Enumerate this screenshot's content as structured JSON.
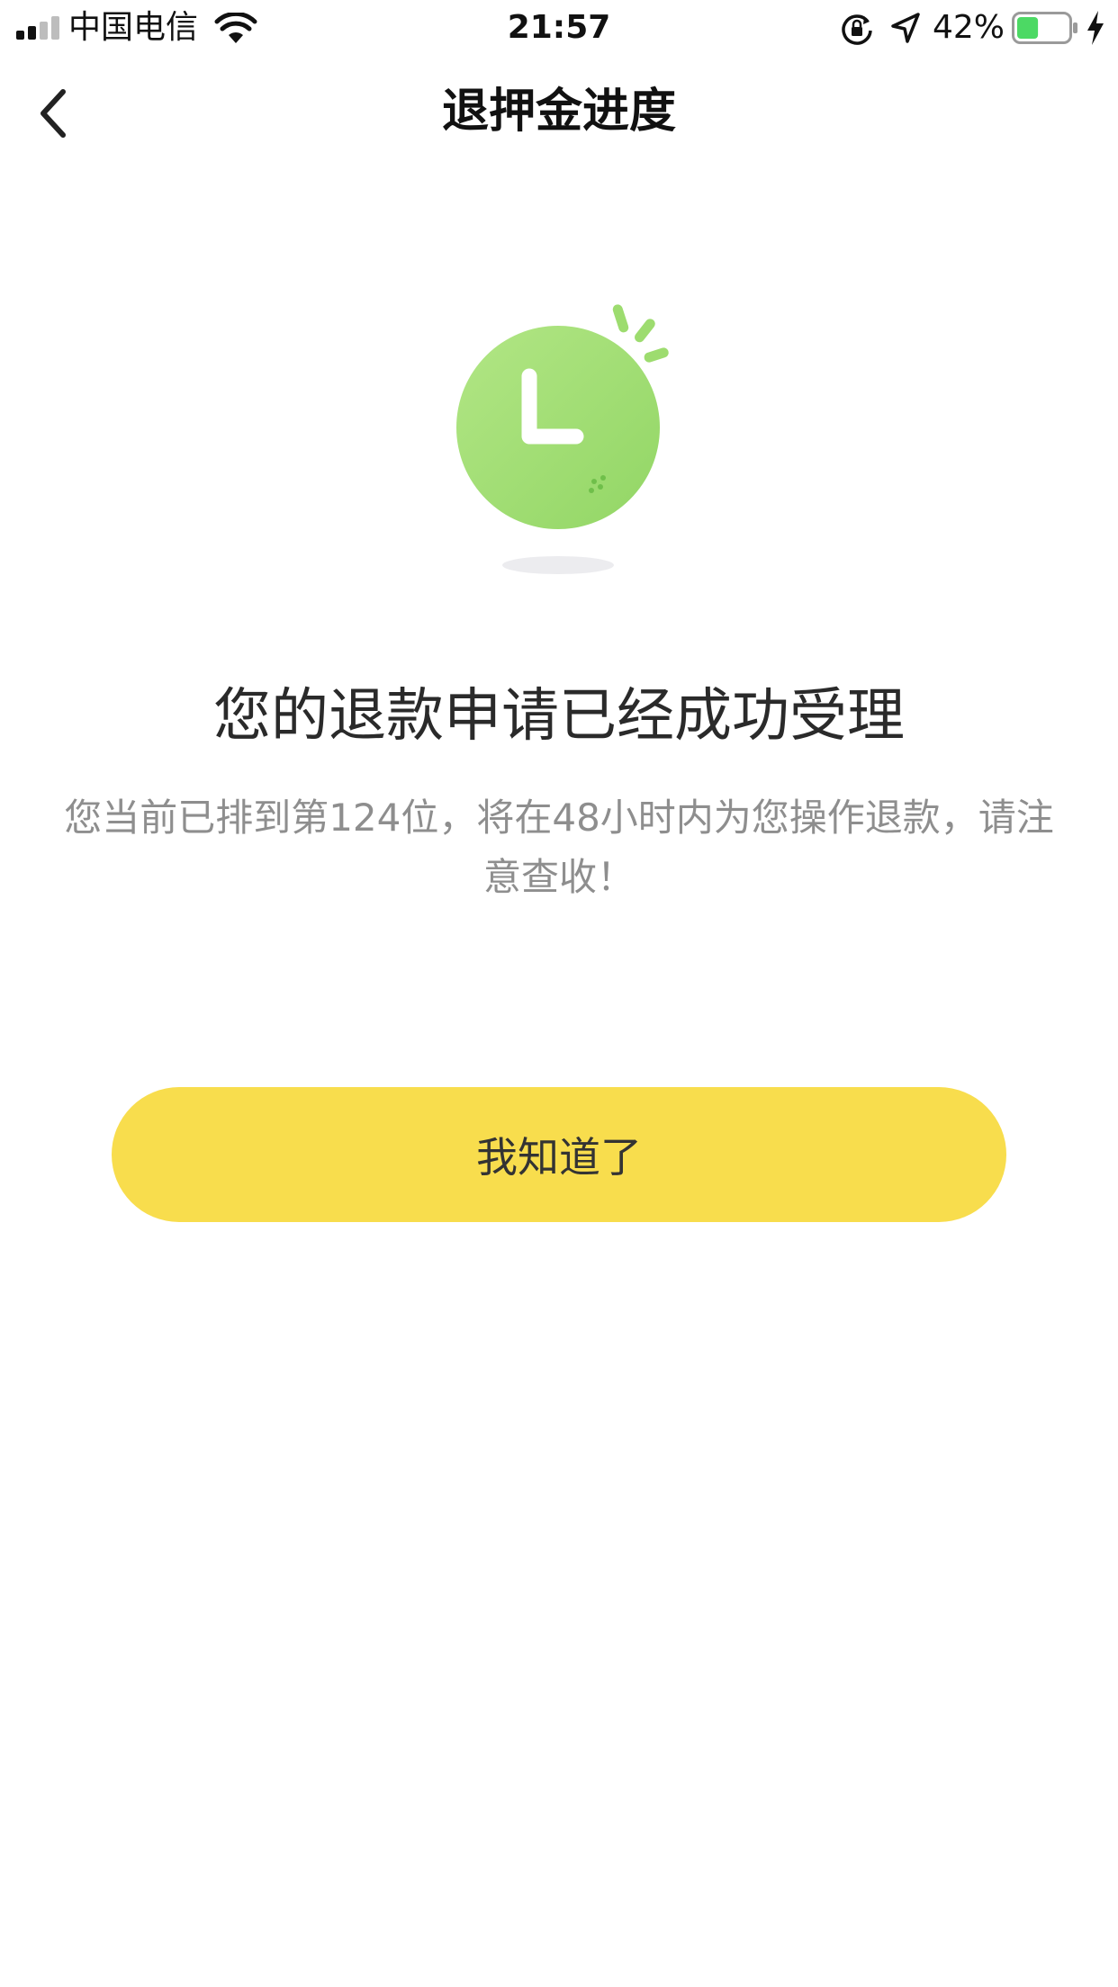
{
  "status_bar": {
    "carrier": "中国电信",
    "time": "21:57",
    "battery_percent": "42%",
    "battery_level": 0.42,
    "battery_color": "#4cd964",
    "icons": [
      "signal-icon",
      "wifi-icon",
      "rotation-lock-icon",
      "location-arrow-icon",
      "battery-icon",
      "charging-bolt-icon"
    ]
  },
  "nav": {
    "title": "退押金进度",
    "back_icon": "chevron-left-icon"
  },
  "illustration": {
    "icon": "clock-icon",
    "color": "#9ddc6f"
  },
  "result": {
    "headline": "您的退款申请已经成功受理",
    "description": "您当前已排到第124位，将在48小时内为您操作退款，请注意查收！"
  },
  "button": {
    "label": "我知道了",
    "color": "#f8dd4d"
  }
}
